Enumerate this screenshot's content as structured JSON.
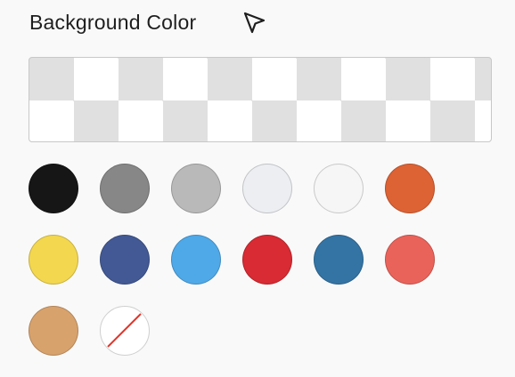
{
  "panel": {
    "title": "Background Color",
    "title_icon": "cursor-arrow-icon"
  },
  "preview": {
    "pattern": "transparency-checkerboard"
  },
  "swatches": [
    {
      "name": "black",
      "color": "#161616",
      "row": 0,
      "col": 0
    },
    {
      "name": "dark-gray",
      "color": "#878787",
      "row": 0,
      "col": 1
    },
    {
      "name": "gray",
      "color": "#b9b9b9",
      "row": 0,
      "col": 2
    },
    {
      "name": "light-gray",
      "color": "#eceef2",
      "row": 0,
      "col": 3
    },
    {
      "name": "off-white",
      "color": "#f6f6f6",
      "row": 0,
      "col": 4
    },
    {
      "name": "orange",
      "color": "#dd6234",
      "row": 0,
      "col": 5
    },
    {
      "name": "yellow",
      "color": "#f3d74f",
      "row": 1,
      "col": 0
    },
    {
      "name": "indigo",
      "color": "#425995",
      "row": 1,
      "col": 1
    },
    {
      "name": "sky-blue",
      "color": "#4fa9e8",
      "row": 1,
      "col": 2
    },
    {
      "name": "red",
      "color": "#d82b33",
      "row": 1,
      "col": 3
    },
    {
      "name": "steel-blue",
      "color": "#3474a5",
      "row": 1,
      "col": 4
    },
    {
      "name": "salmon",
      "color": "#ea635a",
      "row": 1,
      "col": 5
    },
    {
      "name": "tan",
      "color": "#d8a26c",
      "row": 2,
      "col": 0
    },
    {
      "name": "no-color",
      "color": "#ffffff",
      "row": 2,
      "col": 1,
      "none": true
    }
  ]
}
